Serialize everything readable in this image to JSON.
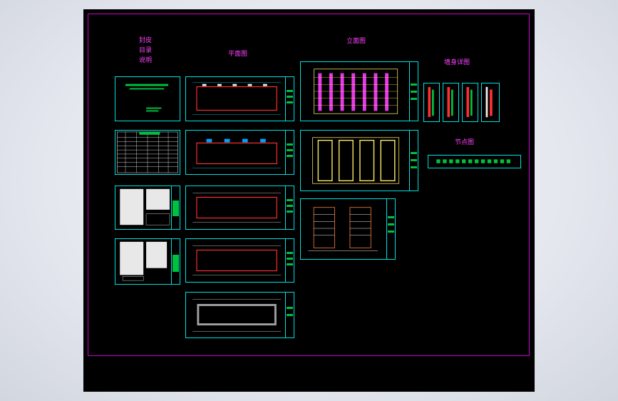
{
  "labels": {
    "cover_1": "封皮",
    "cover_2": "目录",
    "cover_3": "说明",
    "plan": "平面图",
    "elevation": "立面图",
    "wall_detail": "墙身详图",
    "node_detail": "节点图"
  },
  "colors": {
    "frame": "#d000d0",
    "sheet_border": "#00e0e0",
    "label": "#ff40ff",
    "accent_green": "#00c040",
    "plan_red": "#ff3030",
    "elev_yellow": "#f0e060"
  }
}
